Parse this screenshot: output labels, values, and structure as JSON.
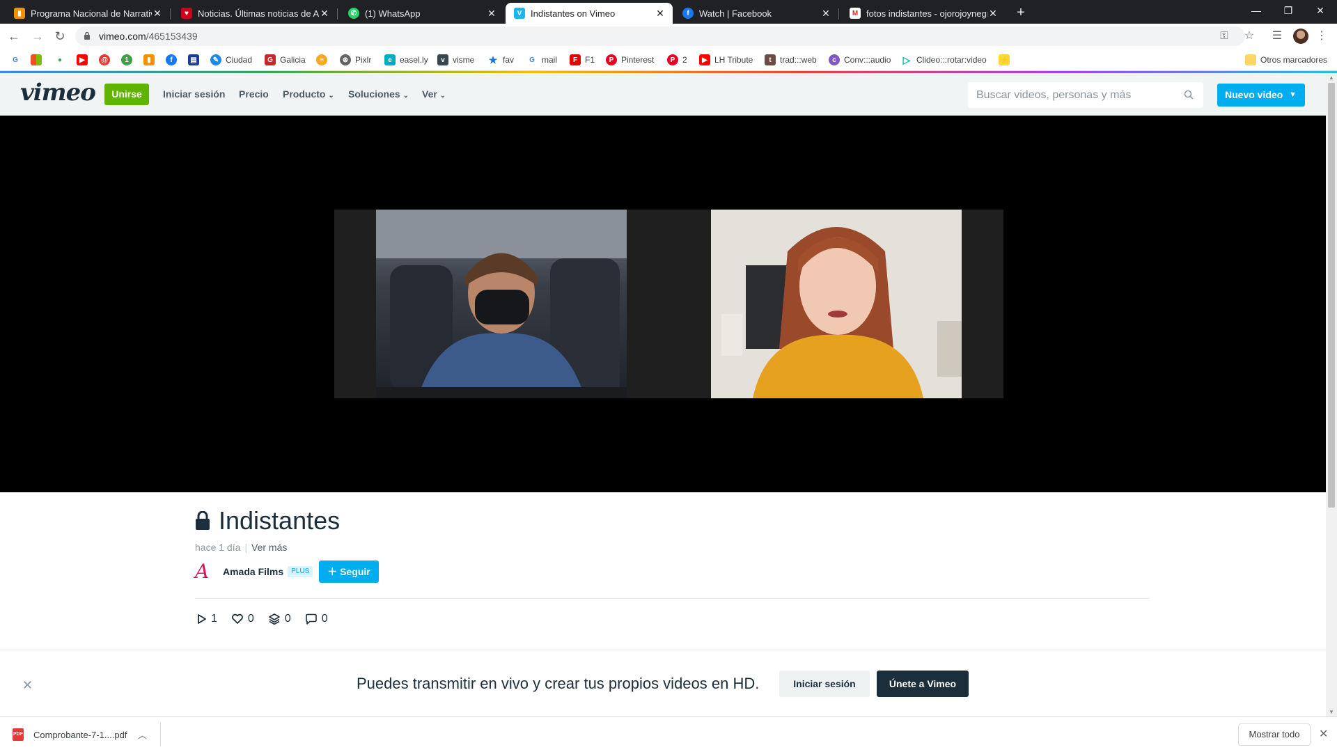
{
  "tabs": [
    {
      "title": "Programa Nacional de Narrativas",
      "favicon_color": "#f29100",
      "favicon": "orange-bars-icon"
    },
    {
      "title": "Noticias. Últimas noticias de Arg",
      "favicon_color": "#d0021b",
      "favicon": "red-heart-icon"
    },
    {
      "title": "(1) WhatsApp",
      "favicon_color": "#25d366",
      "favicon": "whatsapp-icon"
    },
    {
      "title": "Indistantes on Vimeo",
      "favicon_color": "#1ab7ea",
      "favicon": "vimeo-icon"
    },
    {
      "title": "Watch | Facebook",
      "favicon_color": "#1877f2",
      "favicon": "facebook-icon"
    },
    {
      "title": "fotos indistantes - ojorojoynegro",
      "favicon_color": "#d93025",
      "favicon": "gmail-icon"
    }
  ],
  "active_tab_index": 3,
  "address_bar": {
    "url_host": "vimeo.com",
    "url_path": "/465153439"
  },
  "bookmarks": [
    {
      "label": "",
      "icon": "google-icon",
      "color": "#4285f4"
    },
    {
      "label": "",
      "icon": "microsoft-icon",
      "color": "#f25022"
    },
    {
      "label": "",
      "icon": "maps-icon",
      "color": "#34a853"
    },
    {
      "label": "",
      "icon": "youtube-icon",
      "color": "#ff0000"
    },
    {
      "label": "",
      "icon": "red-swirl-icon",
      "color": "#e53935"
    },
    {
      "label": "",
      "icon": "green-one-icon",
      "color": "#43a047"
    },
    {
      "label": "",
      "icon": "orange-bars-icon",
      "color": "#f29100"
    },
    {
      "label": "",
      "icon": "facebook-icon",
      "color": "#1877f2"
    },
    {
      "label": "",
      "icon": "news-icon",
      "color": "#1a3e8c"
    },
    {
      "label": "Ciudad",
      "icon": "ciudad-icon",
      "color": "#1e88e5"
    },
    {
      "label": "Galicia",
      "icon": "galicia-icon",
      "color": "#c62828"
    },
    {
      "label": "",
      "icon": "burger-icon",
      "color": "#f9a825"
    },
    {
      "label": "Pixlr",
      "icon": "pixlr-icon",
      "color": "#616161"
    },
    {
      "label": "easel.ly",
      "icon": "easelly-icon",
      "color": "#00acc1"
    },
    {
      "label": "visme",
      "icon": "visme-icon",
      "color": "#37474f"
    },
    {
      "label": "fav",
      "icon": "star-icon",
      "color": "#1a73e8"
    },
    {
      "label": "mail",
      "icon": "google-icon",
      "color": "#4285f4"
    },
    {
      "label": "F1",
      "icon": "f1-icon",
      "color": "#e10600"
    },
    {
      "label": "Pinterest",
      "icon": "pinterest-icon",
      "color": "#e60023"
    },
    {
      "label": "2",
      "icon": "pinterest-icon",
      "color": "#e60023"
    },
    {
      "label": "LH Tribute",
      "icon": "youtube-icon",
      "color": "#ff0000"
    },
    {
      "label": "trad:::web",
      "icon": "trad-icon",
      "color": "#6d4c41"
    },
    {
      "label": "Conv:::audio",
      "icon": "conv-icon",
      "color": "#7e57c2"
    },
    {
      "label": "Clideo:::rotar:video",
      "icon": "clideo-icon",
      "color": "#00bfa5"
    },
    {
      "label": "",
      "icon": "yellow-bolt-icon",
      "color": "#fdd835"
    }
  ],
  "bookmarks_other": "Otros marcadores",
  "vimeo": {
    "logo": "vimeo",
    "join_label": "Unirse",
    "nav": [
      "Iniciar sesión",
      "Precio",
      "Producto",
      "Soluciones",
      "Ver"
    ],
    "search_placeholder": "Buscar videos, personas y más",
    "new_video_label": "Nuevo video",
    "accent_green": "#5fb400",
    "accent_blue": "#00adef"
  },
  "video": {
    "title": "Indistantes",
    "posted": "hace 1 día",
    "see_more": "Ver más",
    "owner": "Amada Films",
    "owner_badge": "PLUS",
    "follow_label": "Seguir",
    "stats": {
      "plays": "1",
      "likes": "0",
      "collections": "0",
      "comments": "0"
    }
  },
  "promo": {
    "text": "Puedes transmitir en vivo y crear tus propios videos en HD.",
    "login_label": "Iniciar sesión",
    "join_label": "Únete a Vimeo"
  },
  "downloads": {
    "file_name": "Comprobante-7-1....pdf",
    "file_badge": "PDF",
    "show_all_label": "Mostrar todo"
  }
}
